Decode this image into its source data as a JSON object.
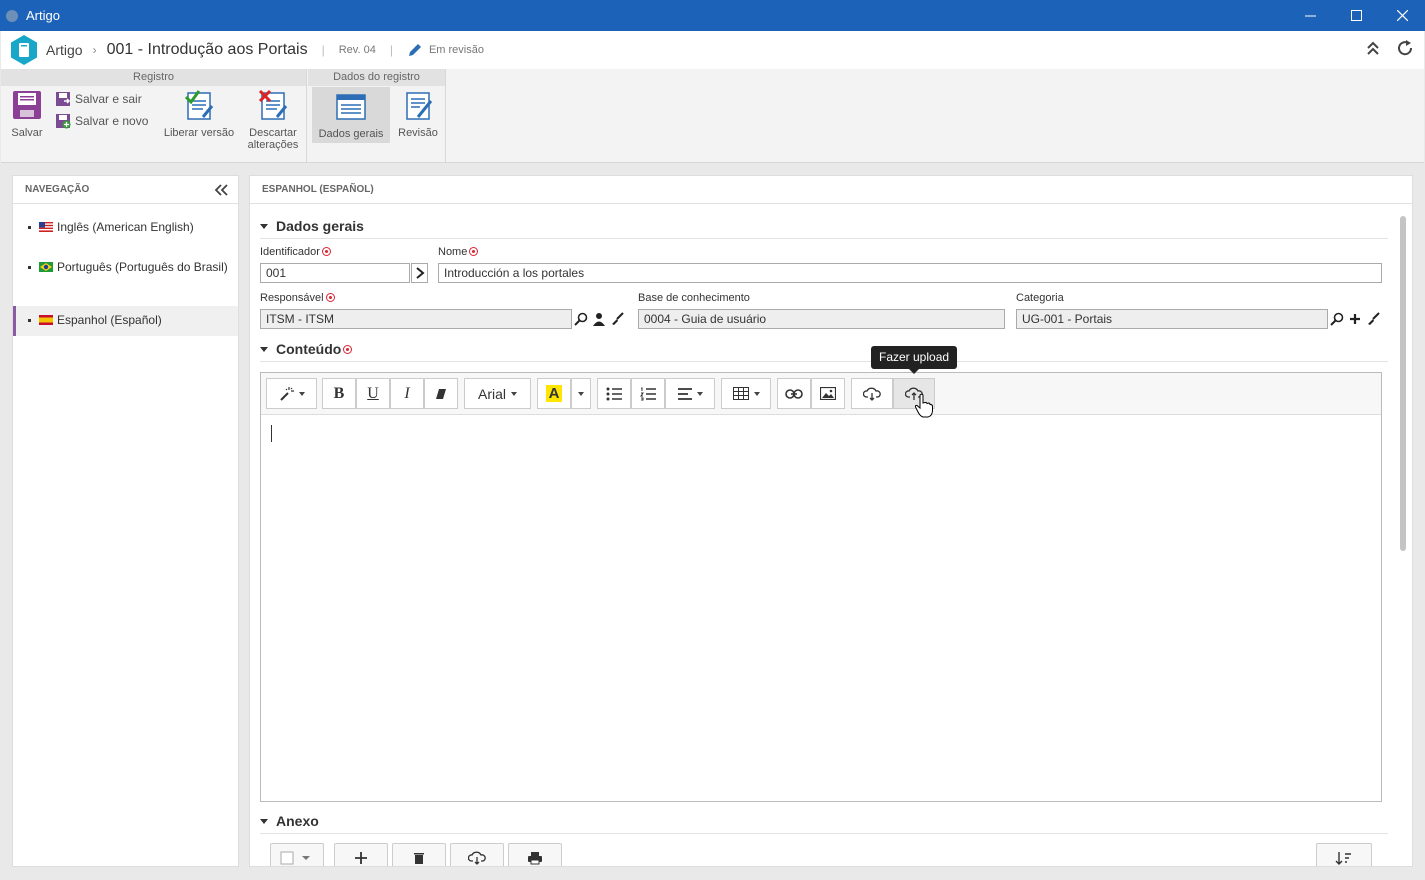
{
  "window": {
    "title": "Artigo"
  },
  "header": {
    "app_label": "Artigo",
    "record_title": "001 - Introdução aos Portais",
    "revision": "Rev. 04",
    "status": "Em revisão"
  },
  "ribbon": {
    "group_registro": "Registro",
    "group_dados": "Dados do registro",
    "save": "Salvar",
    "save_exit": "Salvar e sair",
    "save_new": "Salvar e novo",
    "release": "Liberar versão",
    "discard_1": "Descartar",
    "discard_2": "alterações",
    "general_data": "Dados gerais",
    "revision": "Revisão"
  },
  "nav": {
    "title": "NAVEGAÇÃO",
    "items": [
      {
        "label": "Inglês (American English)"
      },
      {
        "label": "Português (Português do Brasil)"
      },
      {
        "label": "Espanhol (Español)"
      }
    ]
  },
  "main": {
    "title": "ESPANHOL (ESPAÑOL)",
    "section_general": "Dados gerais",
    "identifier_label": "Identificador",
    "identifier_value": "001",
    "name_label": "Nome",
    "name_value": "Introducción a los portales",
    "responsible_label": "Responsável",
    "responsible_value": "ITSM - ITSM",
    "kb_label": "Base de conhecimento",
    "kb_value": "0004 - Guia de usuário",
    "category_label": "Categoria",
    "category_value": "UG-001 - Portais",
    "section_content": "Conteúdo",
    "section_attach": "Anexo"
  },
  "editor": {
    "font": "Arial",
    "tooltip": "Fazer upload",
    "bold": "B",
    "underline": "U",
    "italic": "I",
    "highlight": "A"
  }
}
